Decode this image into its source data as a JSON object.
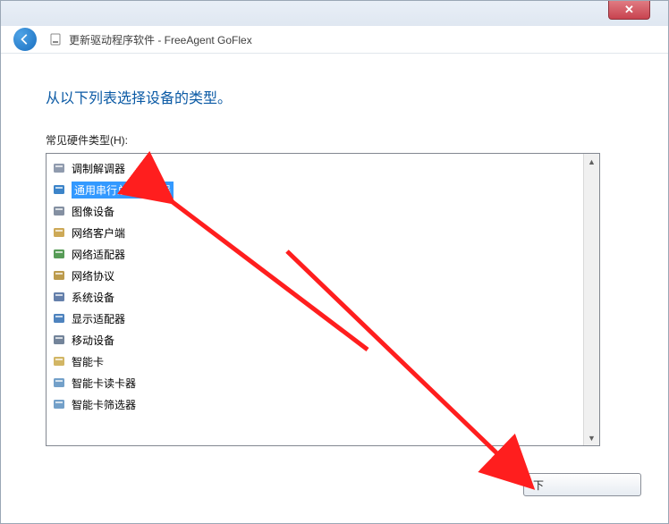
{
  "window": {
    "close_glyph": "✕",
    "title": "更新驱动程序软件 - FreeAgent GoFlex"
  },
  "body": {
    "heading": "从以下列表选择设备的类型。",
    "list_label": "常见硬件类型(H):"
  },
  "list": {
    "items": [
      {
        "label": "调制解调器",
        "icon": "modem-icon",
        "selected": false
      },
      {
        "label": "通用串行总线控制器",
        "icon": "usb-icon",
        "selected": true
      },
      {
        "label": "图像设备",
        "icon": "imaging-icon",
        "selected": false
      },
      {
        "label": "网络客户端",
        "icon": "network-client-icon",
        "selected": false
      },
      {
        "label": "网络适配器",
        "icon": "network-adapter-icon",
        "selected": false
      },
      {
        "label": "网络协议",
        "icon": "network-protocol-icon",
        "selected": false
      },
      {
        "label": "系统设备",
        "icon": "system-device-icon",
        "selected": false
      },
      {
        "label": "显示适配器",
        "icon": "display-adapter-icon",
        "selected": false
      },
      {
        "label": "移动设备",
        "icon": "mobile-device-icon",
        "selected": false
      },
      {
        "label": "智能卡",
        "icon": "smartcard-icon",
        "selected": false
      },
      {
        "label": "智能卡读卡器",
        "icon": "smartcard-reader-icon",
        "selected": false
      },
      {
        "label": "智能卡筛选器",
        "icon": "smartcard-filter-icon",
        "selected": false
      }
    ]
  },
  "footer": {
    "next_label": "下"
  },
  "icons": {
    "modem-icon": "#7d8aa0",
    "usb-icon": "#1a6fc0",
    "imaging-icon": "#6f7c92",
    "network-client-icon": "#c49a3a",
    "network-adapter-icon": "#3a8b3a",
    "network-protocol-icon": "#b08a2e",
    "system-device-icon": "#4a6a9c",
    "display-adapter-icon": "#2f6db3",
    "mobile-device-icon": "#5a6f88",
    "smartcard-icon": "#caa94a",
    "smartcard-reader-icon": "#5a8fbf",
    "smartcard-filter-icon": "#5a8fbf"
  }
}
